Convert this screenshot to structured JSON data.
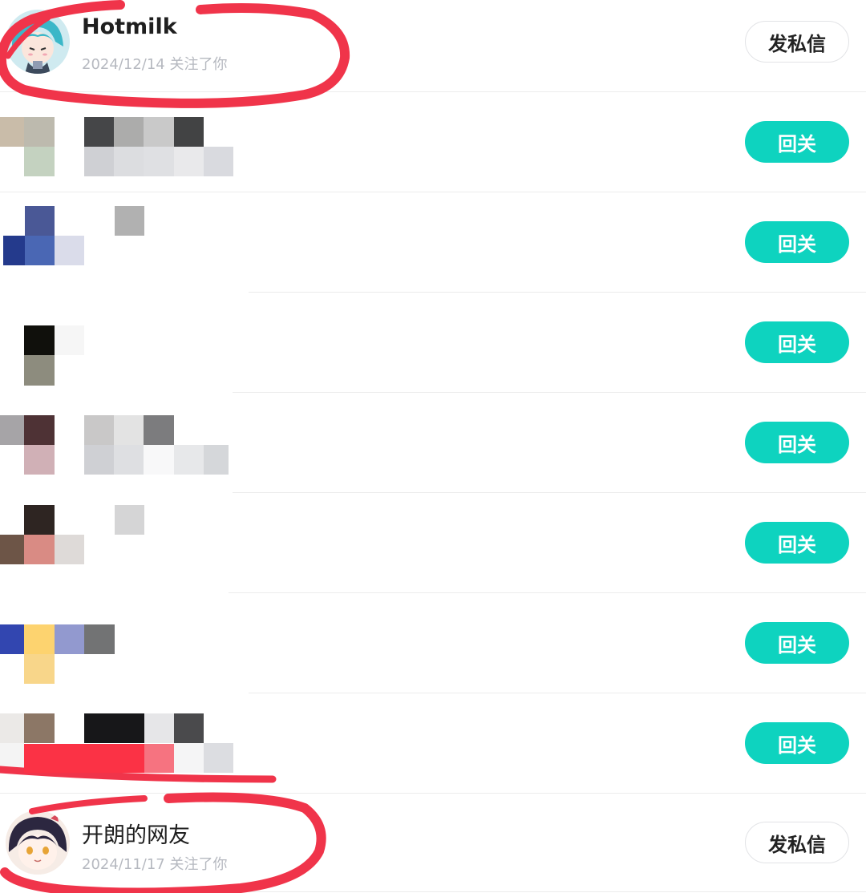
{
  "rows": [
    {
      "name": "Hotmilk",
      "meta": "2024/12/14 关注了你",
      "button": "发私信"
    },
    {
      "button": "回关"
    },
    {
      "button": "回关"
    },
    {
      "button": "回关"
    },
    {
      "button": "回关"
    },
    {
      "button": "回关"
    },
    {
      "button": "回关"
    },
    {
      "button": "回关"
    },
    {
      "name": "开朗的网友",
      "meta": "2024/11/17 关注了你",
      "button": "发私信"
    }
  ],
  "colors": {
    "accent": "#0ed3bf",
    "annotation": "#f0344a",
    "meta": "#b6b9c0"
  },
  "icons": {
    "first_avatar": "anime-teal-hair-avatar",
    "last_avatar": "anime-dark-hair-avatar"
  }
}
